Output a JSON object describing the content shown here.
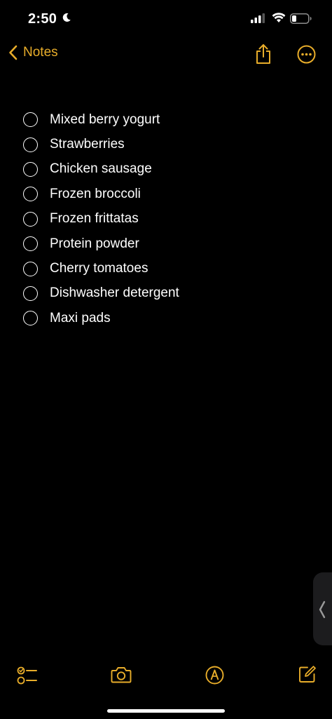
{
  "status_bar": {
    "time": "2:50"
  },
  "nav": {
    "back_label": "Notes"
  },
  "checklist": [
    {
      "text": "Mixed berry yogurt"
    },
    {
      "text": "Strawberries"
    },
    {
      "text": "Chicken sausage"
    },
    {
      "text": "Frozen broccoli"
    },
    {
      "text": "Frozen frittatas"
    },
    {
      "text": "Protein powder"
    },
    {
      "text": "Cherry tomatoes"
    },
    {
      "text": "Dishwasher detergent"
    },
    {
      "text": "Maxi pads"
    }
  ],
  "icons": {
    "moon": "moon-icon",
    "signal": "cellular-signal-icon",
    "wifi": "wifi-icon",
    "battery": "battery-icon",
    "back": "chevron-left-icon",
    "share": "share-icon",
    "more": "more-ellipsis-icon",
    "checklist": "checklist-icon",
    "camera": "camera-icon",
    "markup": "markup-pen-icon",
    "compose": "compose-icon",
    "handle": "chevron-left-icon"
  },
  "colors": {
    "accent": "#e8ad2a",
    "background": "#000000",
    "text": "#ffffff"
  }
}
